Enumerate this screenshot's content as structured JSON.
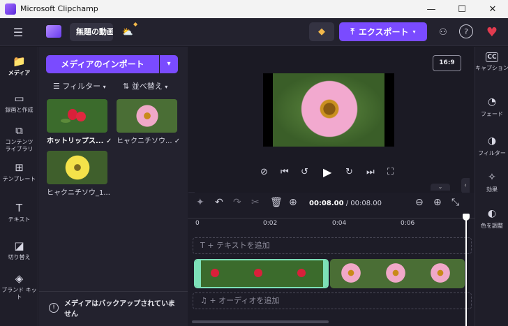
{
  "window": {
    "title": "Microsoft Clipchamp",
    "min": "—",
    "max": "☐",
    "close": "✕"
  },
  "topbar": {
    "project_name": "無題の動画",
    "export_label": "エクスポート",
    "export_arrow": "⤒"
  },
  "leftnav": {
    "items": [
      {
        "label": "メディア",
        "icon": "media-icon",
        "glyph": "📁"
      },
      {
        "label": "録画と作成",
        "icon": "record-icon",
        "glyph": "▭"
      },
      {
        "label": "コンテンツ ライブラリ",
        "icon": "library-icon",
        "glyph": "⧉"
      },
      {
        "label": "テンプレート",
        "icon": "template-icon",
        "glyph": "⊞"
      },
      {
        "label": "テキスト",
        "icon": "text-icon",
        "glyph": "T"
      },
      {
        "label": "切り替え",
        "icon": "transition-icon",
        "glyph": "◪"
      },
      {
        "label": "ブランド キット",
        "icon": "brand-icon",
        "glyph": "◈"
      }
    ]
  },
  "media": {
    "import_label": "メディアのインポート",
    "filter_label": "フィルター",
    "sort_label": "並べ替え",
    "items": [
      {
        "name": "ホットリップス...",
        "check": "✓",
        "bold": true
      },
      {
        "name": "ヒャクニチソウ...",
        "check": "✓",
        "bold": false
      },
      {
        "name": "ヒャクニチソウ_1...",
        "check": "",
        "bold": false
      }
    ],
    "backup_text": "メディアはバックアップされていません"
  },
  "preview": {
    "aspect": "16:9"
  },
  "rightnav": {
    "items": [
      {
        "label": "キャプション",
        "icon": "caption-icon",
        "glyph": "CC"
      },
      {
        "label": "フェード",
        "icon": "fade-icon",
        "glyph": "◔"
      },
      {
        "label": "フィルター",
        "icon": "filter-icon",
        "glyph": "◑"
      },
      {
        "label": "効果",
        "icon": "effects-icon",
        "glyph": "✧"
      },
      {
        "label": "色を調整",
        "icon": "color-icon",
        "glyph": "◐"
      }
    ]
  },
  "timeline": {
    "time_current": "00:08.00",
    "time_sep": "/",
    "time_total": "00:08.00",
    "ticks": [
      "0",
      "0:02",
      "0:04",
      "0:06"
    ],
    "text_track": "+ テキストを追加",
    "audio_track": "+ オーディオを追加"
  }
}
